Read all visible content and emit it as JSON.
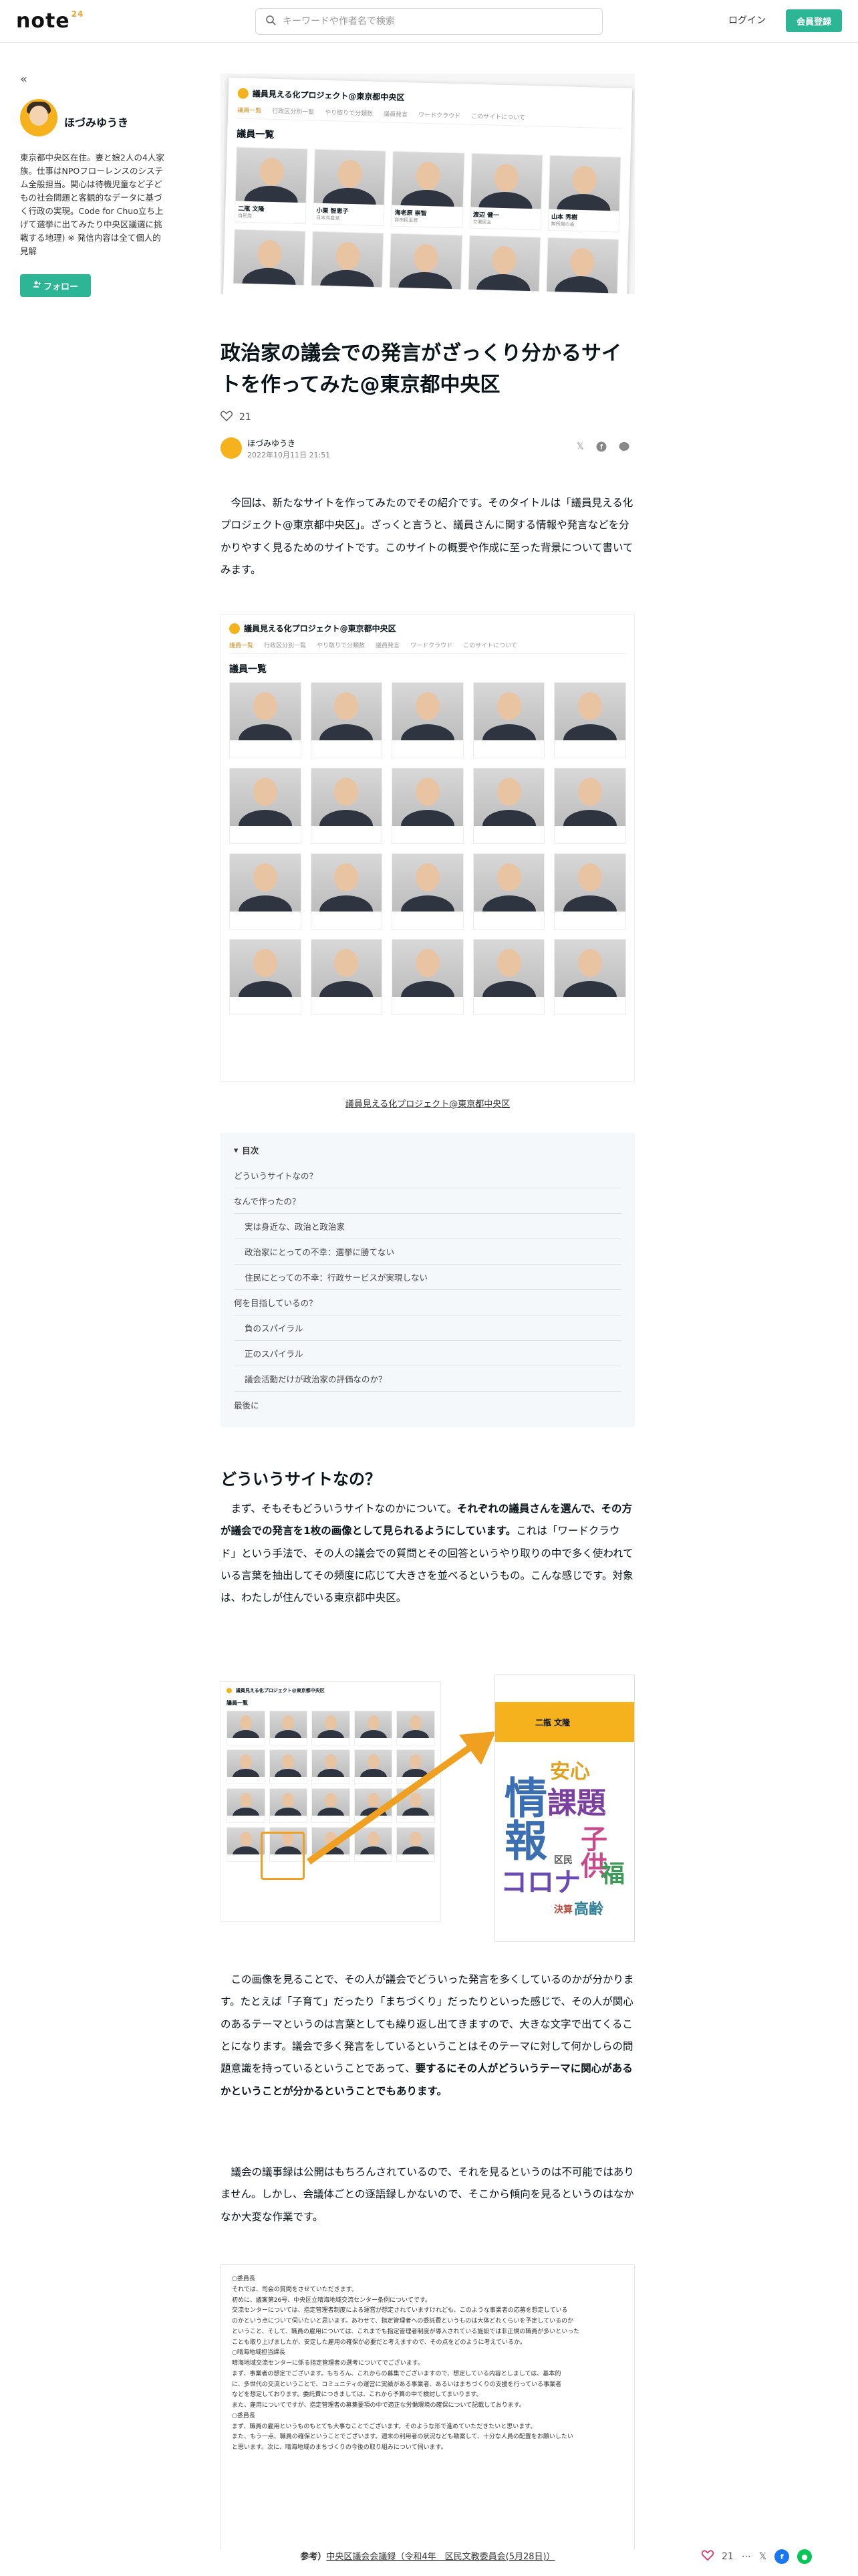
{
  "header": {
    "logo": "note",
    "logo_badge": "24",
    "search_placeholder": "キーワードや作者名で検索",
    "login": "ログイン",
    "signup": "会員登録"
  },
  "sidebar": {
    "author": "ほづみゆうき",
    "bio": "東京都中央区在住。妻と娘2人の4人家族。仕事はNPOフローレンスのシステム全般担当。関心は待機児童など子どもの社会問題と客観的なデータに基づく行政の実現。Code for Chuo立ち上げて選挙に出てみたり中央区議選に挑戦する地理) ※ 発信内容は全て個人的見解",
    "follow": "フォロー"
  },
  "hero": {
    "site_title": "議員見える化プロジェクト@東京都中央区",
    "tabs": [
      "議員一覧",
      "行政区分別一覧",
      "やり取りで分類数",
      "議員発言",
      "ワードクラウド",
      "このサイトについて"
    ],
    "heading": "議員一覧",
    "members": [
      {
        "name": "二瓶 文隆",
        "party": "自民党"
      },
      {
        "name": "小栗 智恵子",
        "party": "日本共産党"
      },
      {
        "name": "海老原 崇智",
        "party": "自由民主党"
      },
      {
        "name": "渡辺 健一",
        "party": "立憲民主"
      },
      {
        "name": "山本 秀樹",
        "party": "無所属の会"
      }
    ]
  },
  "article": {
    "title": "政治家の議会での発言がざっくり分かるサイトを作ってみた@東京都中央区",
    "likes": "21",
    "author": "ほづみゆうき",
    "date": "2022年10月11日 21:51",
    "intro": "今回は、新たなサイトを作ってみたのでその紹介です。そのタイトルは「議員見える化プロジェクト@東京都中央区」。ざっくと言うと、議員さんに関する情報や発言などを分かりやすく見るためのサイトです。このサイトの概要や作成に至った背景について書いてみます。",
    "image_caption": "議員見える化プロジェクト@東京都中央区",
    "toc_heading": "目次",
    "toc": [
      {
        "label": "どういうサイトなの？",
        "sub": false
      },
      {
        "label": "なんで作ったの？",
        "sub": false
      },
      {
        "label": "実は身近な、政治と政治家",
        "sub": true
      },
      {
        "label": "政治家にとっての不幸：選挙に勝てない",
        "sub": true
      },
      {
        "label": "住民にとっての不幸：行政サービスが実現しない",
        "sub": true
      },
      {
        "label": "何を目指しているの？",
        "sub": false
      },
      {
        "label": "負のスパイラル",
        "sub": true
      },
      {
        "label": "正のスパイラル",
        "sub": true
      },
      {
        "label": "議会活動だけが政治家の評価なのか？",
        "sub": true
      },
      {
        "label": "最後に",
        "sub": false
      }
    ],
    "h2": "どういうサイトなの？",
    "p1_a": "まず、そもそもどういうサイトなのかについて。",
    "p1_b": "それぞれの議員さんを選んで、その方が議会での発言を1枚の画像として見られるようにしています。",
    "p1_c": "これは「ワードクラウド」という手法で、その人の議会での質問とその回答というやり取りの中で多く使われている言葉を抽出してその頻度に応じて大きさを並べるというもの。こんな感じです。対象は、わたしが住んでいる東京都中央区。",
    "p2_a": "この画像を見ることで、その人が議会でどういった発言を多くしているのかが分かります。たとえば「子育て」だったり「まちづくり」だったりといった感じで、その人が関心のあるテーマというのは言葉としても繰り返し出てきますので、大きな文字で出てくることになります。議会で多く発言をしているということはそのテーマに対して何かしらの問題意識を持っているということであって、",
    "p2_b": "要するにその人がどういうテーマに関心があるかということが分かるということでもあります。",
    "p3": "議会の議事録は公開はもちろんされているので、それを見るというのは不可能ではありません。しかし、会議体ごとの逐語録しかないので、そこから傾向を見るというのはなかなか大変な作業です。",
    "src_caption_prefix": "参考）",
    "src_caption_link": "中央区議会会議録（令和4年　区民文教委員会(5月28日)）"
  },
  "diagram": {
    "panel_name": "二瓶 文隆",
    "words": [
      "情報",
      "安心",
      "課題",
      "子供",
      "コロナ",
      "福",
      "高齢",
      "決算",
      "区民"
    ]
  },
  "source_box": {
    "lines": [
      "○委員長",
      "それでは、司会の質問をさせていただきます。",
      "初めに、議案第26号、中央区立晴海地域交流センター条例についてです。",
      "交流センターについては、指定管理者制度による運営が想定されていますけれども、このような事業者の応募を想定している",
      "のかという点について伺いたいと思います。あわせて、指定管理者への委託費というものは大体どれくらいを予定しているのか",
      "ということ、そして、職員の雇用については、これまでも指定管理者制度が導入されている施設では非正規の職員が多いといった",
      "ことも取り上げましたが、安定した雇用の確保が必要だと考えますので、その点をどのように考えているか。",
      "○晴海地域担当課長",
      "晴海地域交流センターに係る指定管理者の選考についてでございます。",
      "まず、事業者の想定でございます。もちろん、これからの募集でございますので、想定している内容としましては、基本的",
      "に、多世代の交流ということで、コミュニティの運営に実績がある事業者、あるいはまちづくりの支援を行っている事業者",
      "などを想定しております。委託費につきましては、これから予算の中で検討してまいります。",
      "また、雇用についてですが、指定管理者の募集要項の中で適正な労働環境の確保について記載しております。",
      "○委員長",
      "まず、職員の雇用というものもとても大事なことでございます。そのような形で進めていただきたいと思います。",
      "また、もう一点、職員の確保ということでございます。週末の利用者の状況なども勘案して、十分な人員の配置をお願いしたい",
      "と思います。次に、晴海地域のまちづくりの今後の取り組みについて伺います。"
    ]
  }
}
